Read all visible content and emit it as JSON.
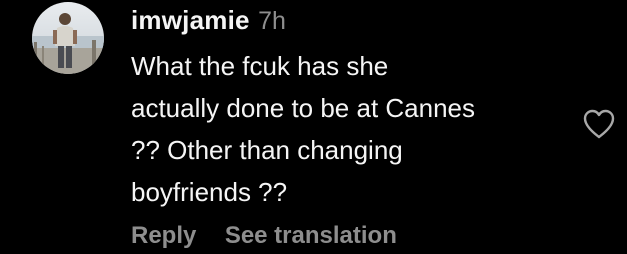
{
  "comment": {
    "avatar_icon": "user-avatar-photo",
    "username": "imwjamie",
    "timestamp": "7h",
    "text_lines": [
      "What the fcuk has she",
      "actually done to be at Cannes",
      "?? Other than changing",
      "boyfriends ??"
    ],
    "actions": {
      "reply": "Reply",
      "see_translation": "See translation"
    },
    "like_icon": "heart-outline-icon"
  },
  "colors": {
    "background": "#000000",
    "primary_text": "#f5f5f5",
    "secondary_text": "#8e8e8e"
  }
}
